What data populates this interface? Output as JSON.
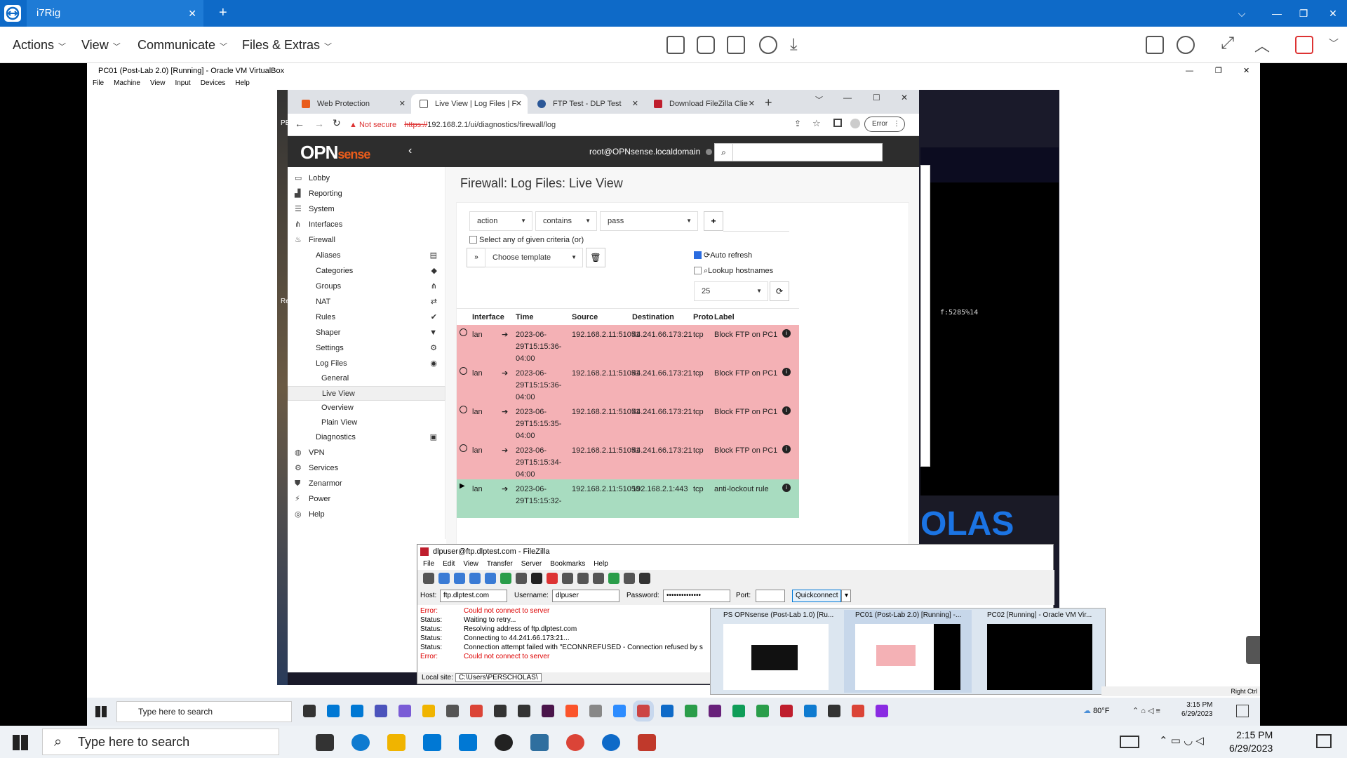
{
  "teamviewer": {
    "tab_title": "i7Rig",
    "menu": [
      "Actions",
      "View",
      "Communicate",
      "Files & Extras"
    ]
  },
  "virtualbox": {
    "title": "PC01 (Post-Lab 2.0) [Running] - Oracle VM VirtualBox",
    "menu": [
      "File",
      "Machine",
      "View",
      "Input",
      "Devices",
      "Help"
    ]
  },
  "chrome": {
    "tabs": [
      {
        "label": "Web Protection",
        "favicon_color": "#e95c1b"
      },
      {
        "label": "Live View | Log Files | F",
        "favicon_color": "#555555"
      },
      {
        "label": "FTP Test - DLP Test",
        "favicon_color": "#2b5797"
      },
      {
        "label": "Download FileZilla Clie",
        "favicon_color": "#bf1e2d"
      }
    ],
    "not_secure": "Not secure",
    "url_scheme": "https://",
    "url_rest": "192.168.2.1/ui/diagnostics/firewall/log",
    "error_badge": "Error"
  },
  "opnsense": {
    "logo_main": "OPN",
    "logo_sense": "sense",
    "user": "root@OPNsense.localdomain",
    "page_title": "Firewall: Log Files: Live View",
    "nav": [
      {
        "label": "Lobby",
        "icon": "laptop-icon",
        "level": 0
      },
      {
        "label": "Reporting",
        "icon": "chart-icon",
        "level": 0
      },
      {
        "label": "System",
        "icon": "list-icon",
        "level": 0
      },
      {
        "label": "Interfaces",
        "icon": "sitemap-icon",
        "level": 0
      },
      {
        "label": "Firewall",
        "icon": "fire-icon",
        "level": 0
      },
      {
        "label": "Aliases",
        "icon": "card-icon",
        "level": 1
      },
      {
        "label": "Categories",
        "icon": "tags-icon",
        "level": 1
      },
      {
        "label": "Groups",
        "icon": "sitemap-icon",
        "level": 1
      },
      {
        "label": "NAT",
        "icon": "exchange-icon",
        "level": 1
      },
      {
        "label": "Rules",
        "icon": "check-icon",
        "level": 1
      },
      {
        "label": "Shaper",
        "icon": "filter-icon",
        "level": 1
      },
      {
        "label": "Settings",
        "icon": "cogs-icon",
        "level": 1
      },
      {
        "label": "Log Files",
        "icon": "eye-icon",
        "level": 1
      },
      {
        "label": "General",
        "icon": "",
        "level": 2
      },
      {
        "label": "Live View",
        "icon": "",
        "level": 2,
        "selected": true
      },
      {
        "label": "Overview",
        "icon": "",
        "level": 2
      },
      {
        "label": "Plain View",
        "icon": "",
        "level": 2
      },
      {
        "label": "Diagnostics",
        "icon": "medkit-icon",
        "level": 1
      },
      {
        "label": "VPN",
        "icon": "globe-icon",
        "level": 0
      },
      {
        "label": "Services",
        "icon": "cog-icon",
        "level": 0
      },
      {
        "label": "Zenarmor",
        "icon": "zenarmor-icon",
        "level": 0
      },
      {
        "label": "Power",
        "icon": "plug-icon",
        "level": 0
      },
      {
        "label": "Help",
        "icon": "lifebuoy-icon",
        "level": 0
      }
    ],
    "filter": {
      "field": "action",
      "operator": "contains",
      "value": "pass",
      "any_criteria_label": "Select any of given criteria (or)",
      "template": "Choose template",
      "auto_refresh_label": "Auto refresh",
      "auto_refresh_checked": true,
      "lookup_label": "Lookup hostnames",
      "lookup_checked": false,
      "limit": "25"
    },
    "table": {
      "headers": [
        "Interface",
        "Time",
        "Source",
        "Destination",
        "Proto",
        "Label"
      ],
      "rows": [
        {
          "action": "block",
          "interface": "lan",
          "time": "2023-06-29T15:15:36-04:00",
          "source": "192.168.2.11:51051",
          "destination": "44.241.66.173:21",
          "proto": "tcp",
          "label": "Block FTP on PC1"
        },
        {
          "action": "block",
          "interface": "lan",
          "time": "2023-06-29T15:15:36-04:00",
          "source": "192.168.2.11:51051",
          "destination": "44.241.66.173:21",
          "proto": "tcp",
          "label": "Block FTP on PC1"
        },
        {
          "action": "block",
          "interface": "lan",
          "time": "2023-06-29T15:15:35-04:00",
          "source": "192.168.2.11:51051",
          "destination": "44.241.66.173:21",
          "proto": "tcp",
          "label": "Block FTP on PC1"
        },
        {
          "action": "block",
          "interface": "lan",
          "time": "2023-06-29T15:15:34-04:00",
          "source": "192.168.2.11:51051",
          "destination": "44.241.66.173:21",
          "proto": "tcp",
          "label": "Block FTP on PC1"
        },
        {
          "action": "pass",
          "interface": "lan",
          "time": "2023-06-29T15:15:32-",
          "source": "192.168.2.11:51050",
          "destination": "192.168.2.1:443",
          "proto": "tcp",
          "label": "anti-lockout rule"
        }
      ]
    }
  },
  "filezilla": {
    "title": "dlpuser@ftp.dlptest.com - FileZilla",
    "menu": [
      "File",
      "Edit",
      "View",
      "Transfer",
      "Server",
      "Bookmarks",
      "Help"
    ],
    "host_label": "Host:",
    "host": "ftp.dlptest.com",
    "username_label": "Username:",
    "username": "dlpuser",
    "password_label": "Password:",
    "password": "••••••••••••••",
    "port_label": "Port:",
    "port": "",
    "quickconnect": "Quickconnect",
    "log": [
      {
        "kind": "Error:",
        "msg": "Could not connect to server",
        "error": true
      },
      {
        "kind": "Status:",
        "msg": "Waiting to retry...",
        "error": false
      },
      {
        "kind": "Status:",
        "msg": "Resolving address of ftp.dlptest.com",
        "error": false
      },
      {
        "kind": "Status:",
        "msg": "Connecting to 44.241.66.173:21...",
        "error": false
      },
      {
        "kind": "Status:",
        "msg": "Connection attempt failed with \"ECONNREFUSED - Connection refused by s",
        "error": false
      },
      {
        "kind": "Error:",
        "msg": "Could not connect to server",
        "error": true
      }
    ],
    "local_site_label": "Local site:",
    "local_site": "C:\\Users\\PERSCHOLAS\\"
  },
  "background_text": {
    "terminal_fragment": "f:5285%14",
    "banner_fragment": "OLAS",
    "vm_left_fragments": [
      "PE",
      "Re"
    ]
  },
  "thumbnails": [
    {
      "title": "PS OPNsense (Post-Lab 1.0) [Ru..."
    },
    {
      "title": "PC01 (Post-Lab 2.0) [Running] -..."
    },
    {
      "title": "PC02 [Running] - Oracle VM Vir..."
    }
  ],
  "vm_taskbar": {
    "search_placeholder": "Type here to search",
    "temperature": "80°F",
    "time": "3:15 PM",
    "date": "6/29/2023",
    "host_key": "Right Ctrl"
  },
  "host_taskbar": {
    "search_placeholder": "Type here to search",
    "time": "2:15 PM",
    "date": "6/29/2023"
  }
}
